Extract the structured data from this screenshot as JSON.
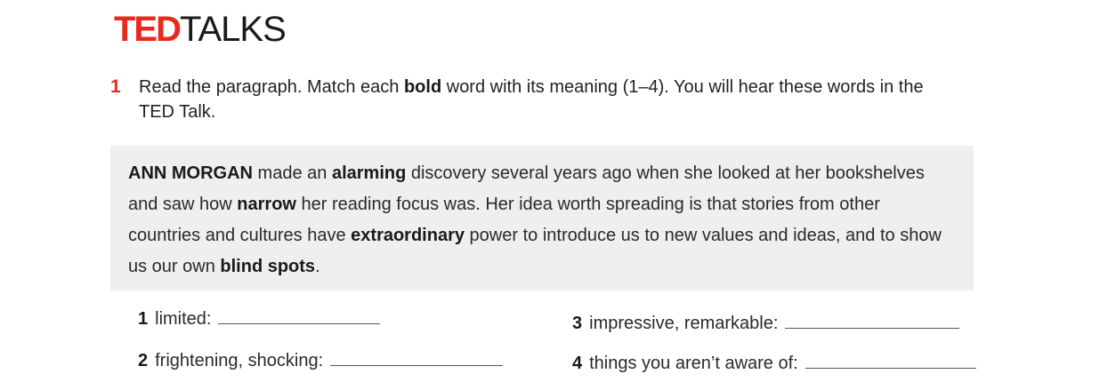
{
  "logo": {
    "ted": "TED",
    "talks": "TALKS"
  },
  "instruction": {
    "number": "1",
    "parts": [
      "Read the paragraph. Match each ",
      "bold",
      " word with its meaning (1–4). You will hear these words in the TED Talk."
    ]
  },
  "passage": {
    "parts": [
      "ANN MORGAN",
      " made an ",
      "alarming",
      " discovery several years ago when she looked at her bookshelves and saw how ",
      "narrow",
      " her reading focus was. Her idea worth spreading is that stories from other countries and cultures have ",
      "extraordinary",
      " power to introduce us to new values and ideas, and to show us our own ",
      "blind spots",
      "."
    ]
  },
  "items": [
    {
      "num": "1",
      "text": "limited:"
    },
    {
      "num": "2",
      "text": "frightening, shocking:"
    },
    {
      "num": "3",
      "text": "impressive, remarkable:"
    },
    {
      "num": "4",
      "text": "things you aren’t aware of:"
    }
  ]
}
